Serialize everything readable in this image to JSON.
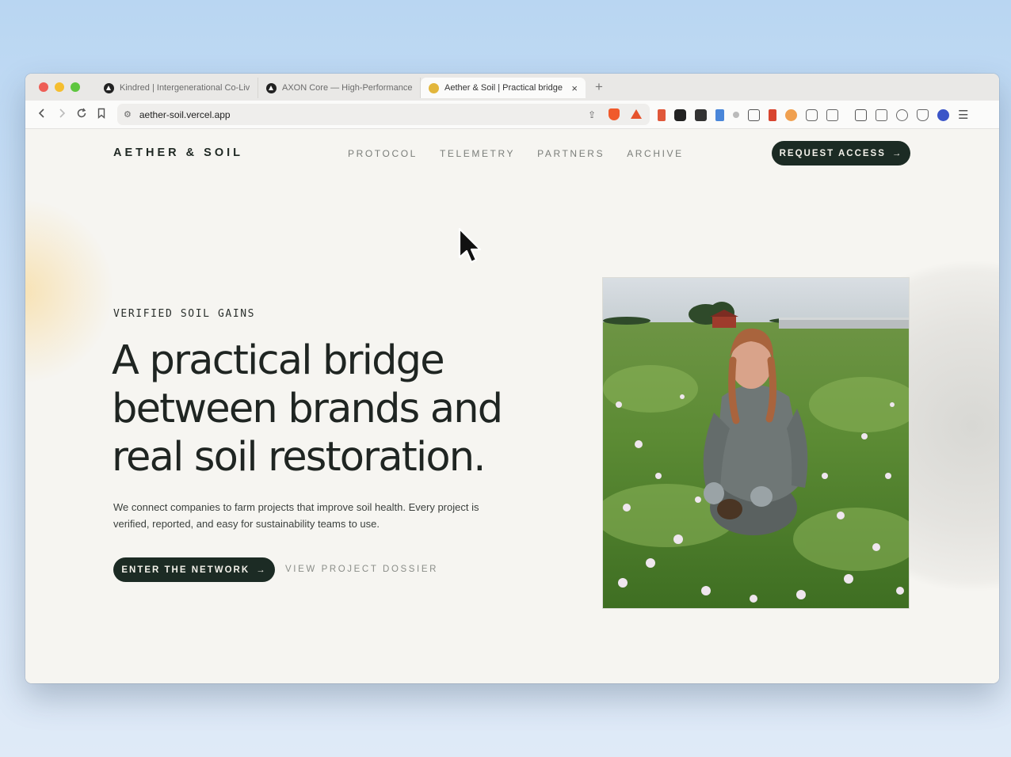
{
  "browser": {
    "tabs": [
      {
        "title": "Kindred | Intergenerational Co-Living",
        "active": false,
        "favicon": "vercel-triangle-icon"
      },
      {
        "title": "AXON Core — High-Performance N",
        "active": false,
        "favicon": "vercel-triangle-icon"
      },
      {
        "title": "Aether & Soil | Practical bridge",
        "active": true,
        "favicon": "sun-icon"
      }
    ],
    "close_glyph": "×",
    "new_tab_glyph": "+",
    "url": "aether-soil.vercel.app"
  },
  "site": {
    "brand": "AETHER & SOIL",
    "nav": [
      "PROTOCOL",
      "TELEMETRY",
      "PARTNERS",
      "ARCHIVE"
    ],
    "cta_top": "REQUEST ACCESS",
    "arrow": "→"
  },
  "hero": {
    "eyebrow": "VERIFIED SOIL GAINS",
    "headline": "A practical bridge between brands and real soil restoration.",
    "lede": "We connect companies to farm projects that improve soil health. Every project is verified, reported, and easy for sustainability teams to use.",
    "primary_cta": "ENTER THE NETWORK",
    "secondary_cta": "VIEW PROJECT DOSSIER"
  },
  "colors": {
    "page_bg": "#f6f5f1",
    "dark_green": "#1c2b24",
    "muted_text": "#7a7d79"
  }
}
